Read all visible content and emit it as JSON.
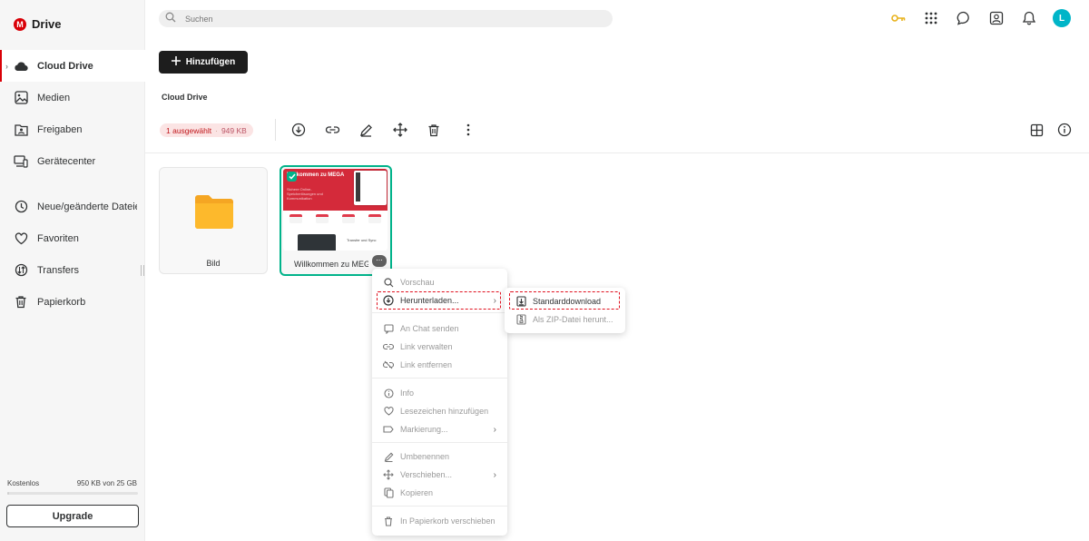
{
  "app": {
    "logo_letter": "M",
    "title": "Drive"
  },
  "sidebar": {
    "items": [
      {
        "label": "Cloud Drive",
        "icon": "cloud-icon",
        "active": true
      },
      {
        "label": "Medien",
        "icon": "image-icon"
      },
      {
        "label": "Freigaben",
        "icon": "shared-folder-icon"
      },
      {
        "label": "Gerätecenter",
        "icon": "devices-icon"
      },
      {
        "label": "Neue/geänderte Dateien",
        "icon": "clock-icon"
      },
      {
        "label": "Favoriten",
        "icon": "heart-icon"
      },
      {
        "label": "Transfers",
        "icon": "transfers-icon"
      },
      {
        "label": "Papierkorb",
        "icon": "trash-icon"
      }
    ],
    "storage": {
      "plan": "Kostenlos",
      "usage": "950 KB von 25 GB",
      "used_fraction": 0.0
    },
    "upgrade_label": "Upgrade"
  },
  "header": {
    "search_placeholder": "Suchen",
    "avatar_letter": "L",
    "accent_color": "#00b5c8"
  },
  "actions": {
    "add_label": "Hinzufügen"
  },
  "breadcrumb": "Cloud Drive",
  "selection": {
    "count_label": "1 ausgewählt",
    "separator": "·",
    "size": "949 KB"
  },
  "files": [
    {
      "name": "Bild",
      "type": "folder"
    },
    {
      "name": "Willkommen zu MEGA",
      "type": "pdf",
      "selected": true,
      "thumb_title": "Willkommen zu MEGA",
      "thumb_sub": "Sichere Online-Speicherlösungen und Kommunikation",
      "thumb_caption": "Transfer und Sync"
    }
  ],
  "context_menu": {
    "items": [
      {
        "label": "Vorschau",
        "icon": "search-icon"
      },
      {
        "label": "Herunterladen...",
        "icon": "download-icon",
        "submenu": true,
        "highlighted": true
      },
      {
        "label": "An Chat senden",
        "icon": "chat-icon"
      },
      {
        "label": "Link verwalten",
        "icon": "link-icon"
      },
      {
        "label": "Link entfernen",
        "icon": "link-off-icon"
      },
      {
        "label": "Info",
        "icon": "info-icon"
      },
      {
        "label": "Lesezeichen hinzufügen",
        "icon": "heart-icon"
      },
      {
        "label": "Markierung...",
        "icon": "tag-icon",
        "submenu": true
      },
      {
        "label": "Umbenennen",
        "icon": "pencil-icon"
      },
      {
        "label": "Verschieben...",
        "icon": "move-icon",
        "submenu": true
      },
      {
        "label": "Kopieren",
        "icon": "copy-icon"
      },
      {
        "label": "In Papierkorb verschieben",
        "icon": "trash-icon"
      }
    ]
  },
  "download_submenu": {
    "items": [
      {
        "label": "Standarddownload",
        "icon": "download-file-icon",
        "highlighted": true
      },
      {
        "label": "Als ZIP-Datei herunt...",
        "icon": "zip-icon"
      }
    ]
  },
  "colors": {
    "brand": "#d90007",
    "selected_border": "#00b38a",
    "highlight_dash": "#e0101e"
  }
}
